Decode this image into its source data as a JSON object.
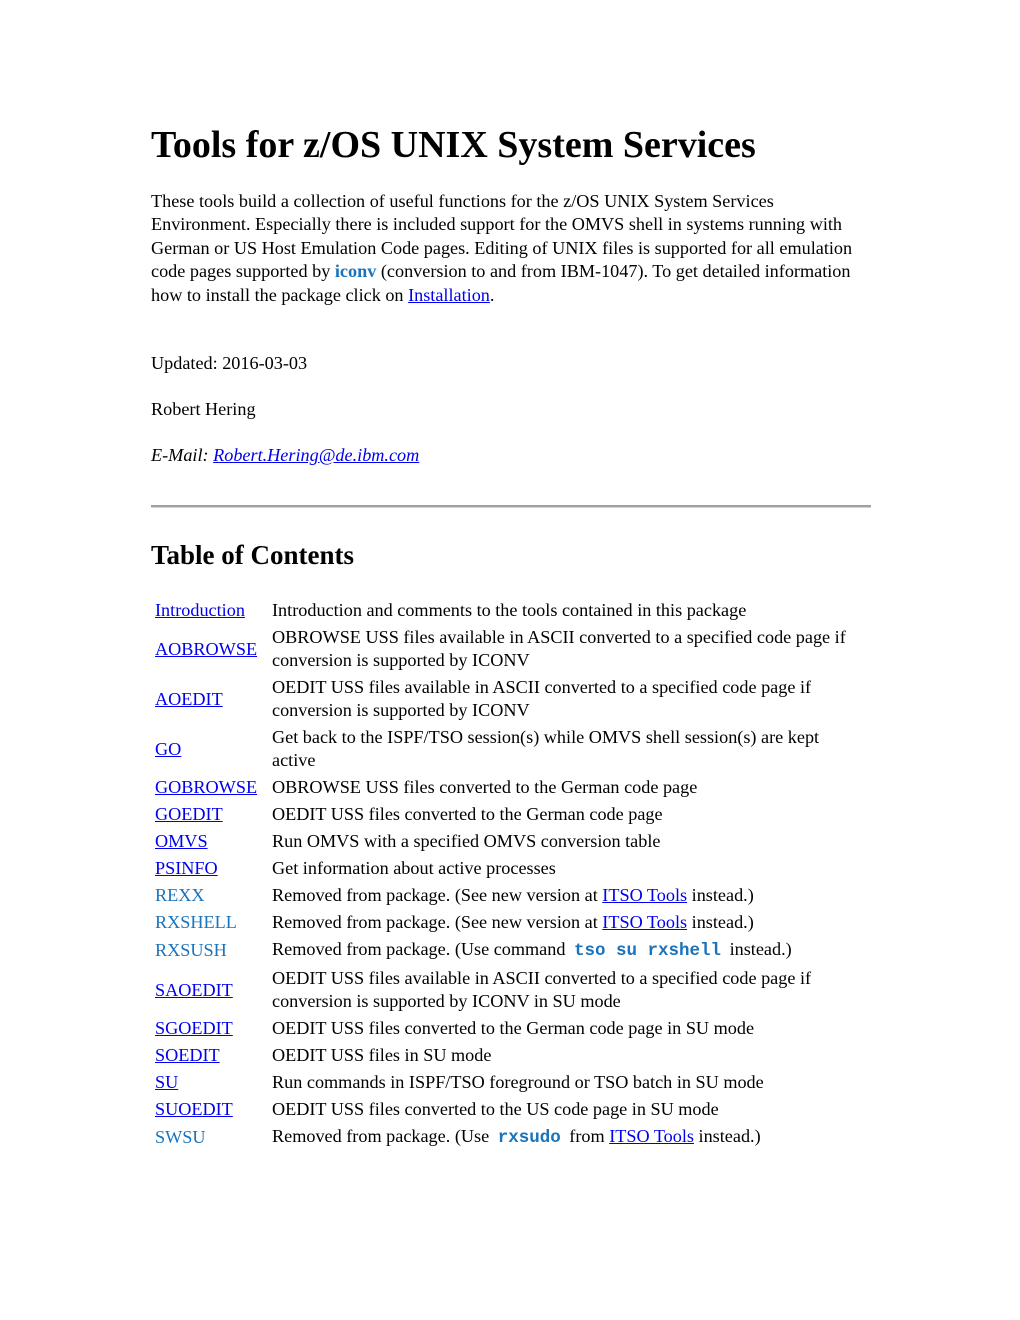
{
  "title": "Tools for z/OS UNIX System Services",
  "intro": {
    "text_before_iconv": "These tools build a collection of useful functions for the z/OS UNIX System Services Environment. Especially there is included support for the OMVS shell in systems running with German or US Host Emulation Code pages. Editing of UNIX files is supported for all emulation code pages supported by ",
    "iconv_label": "iconv",
    "text_after_iconv": " (conversion to and from IBM-1047). To get detailed information how to install the package click on ",
    "installation_link": "Installation",
    "text_end": "."
  },
  "updated": "Updated: 2016-03-03",
  "author": "Robert Hering",
  "email": {
    "label": "E-Mail: ",
    "address": "Robert.Hering@de.ibm.com"
  },
  "toc": {
    "heading": "Table of Contents",
    "rows": [
      {
        "name": "Introduction",
        "link": true,
        "desc": "Introduction and comments to the tools contained in this package"
      },
      {
        "name": "AOBROWSE",
        "link": true,
        "desc": "OBROWSE USS files available in ASCII converted to a specified code page if conversion is supported by ICONV"
      },
      {
        "name": "AOEDIT",
        "link": true,
        "desc": "OEDIT USS files available in ASCII converted to a specified code page if conversion is supported by ICONV"
      },
      {
        "name": "GO",
        "link": true,
        "desc": "Get back to the ISPF/TSO session(s) while OMVS shell session(s) are kept active"
      },
      {
        "name": "GOBROWSE",
        "link": true,
        "desc": "OBROWSE USS files converted to the German code page"
      },
      {
        "name": "GOEDIT",
        "link": true,
        "desc": "OEDIT USS files converted to the German code page"
      },
      {
        "name": "OMVS",
        "link": true,
        "desc": "Run OMVS with a specified OMVS conversion table"
      },
      {
        "name": "PSINFO",
        "link": true,
        "desc": "Get information about active processes"
      },
      {
        "name": "REXX",
        "link": false,
        "desc_before": "Removed from package. (See new version at ",
        "desc_link": "ITSO Tools",
        "desc_after": " instead.)"
      },
      {
        "name": "RXSHELL",
        "link": false,
        "desc_before": "Removed from package. (See new version at ",
        "desc_link": "ITSO Tools",
        "desc_after": " instead.)"
      },
      {
        "name": "RXSUSH",
        "link": false,
        "desc_before": "Removed from package. (Use command ",
        "desc_code": "tso su rxshell",
        "desc_after": " instead.)"
      },
      {
        "name": "SAOEDIT",
        "link": true,
        "desc": "OEDIT USS files available in ASCII converted to a specified code page if conversion is supported by ICONV in SU mode"
      },
      {
        "name": "SGOEDIT",
        "link": true,
        "desc": "OEDIT USS files converted to the German code page in SU mode"
      },
      {
        "name": "SOEDIT",
        "link": true,
        "desc": "OEDIT USS files in SU mode"
      },
      {
        "name": "SU",
        "link": true,
        "desc": "Run commands in ISPF/TSO foreground or TSO batch in SU mode"
      },
      {
        "name": "SUOEDIT",
        "link": true,
        "desc": "OEDIT USS files converted to the US code page in SU mode"
      },
      {
        "name": "SWSU",
        "link": false,
        "desc_before": "Removed from package. (Use ",
        "desc_code": "rxsudo",
        "desc_mid": " from ",
        "desc_link": "ITSO Tools",
        "desc_after": " instead.)"
      }
    ]
  },
  "colors": {
    "link": "#0000ee",
    "accent_blue": "#1a73bb",
    "rule": "#a0a0a0"
  }
}
